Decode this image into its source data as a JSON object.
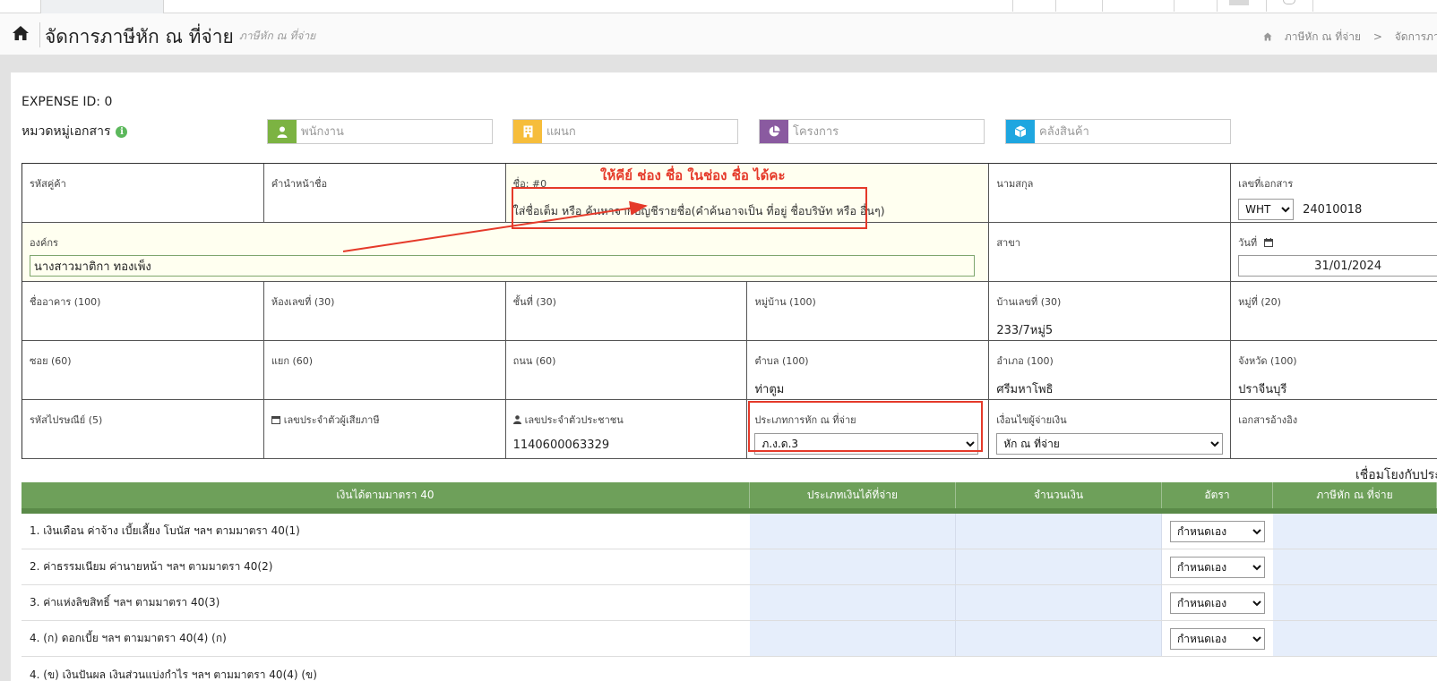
{
  "header": {
    "title": "จัดการภาษีหัก ณ ที่จ่าย",
    "subtitle": "ภาษีหัก ณ ที่จ่าย",
    "breadcrumb": [
      "ภาษีหัก ณ ที่จ่าย",
      "จัดการภาษีห"
    ],
    "breadcrumb_sep": ">"
  },
  "expense_id_label": "EXPENSE ID: 0",
  "doc_category_label": "หมวดหมู่เอกสาร",
  "categories": {
    "employee_placeholder": "พนักงาน",
    "department_placeholder": "แผนก",
    "project_placeholder": "โครงการ",
    "warehouse_placeholder": "คลังสินค้า"
  },
  "colors": {
    "employee": "#7cb342",
    "department": "#f6bd3b",
    "project": "#8a5aa0",
    "warehouse": "#1ea6e0",
    "annotation": "#e53a2a",
    "table_header": "#6ea05a"
  },
  "form": {
    "customer_code_label": "รหัสคู่ค้า",
    "prefix_label": "คำนำหน้าชื่อ",
    "name_label": "ชื่อ: #0",
    "name_hint": "ใส่ชื่อเต็ม หรือ ค้นหาจากบัญชีรายชื่อ(คำค้นอาจเป็น ที่อยู่ ชื่อบริษัท หรือ อื่นๆ)",
    "surname_label": "นามสกุล",
    "doc_no_label": "เลขที่เอกสาร",
    "doc_prefix": "WHT",
    "doc_no_value": "24010018",
    "org_label": "องค์กร",
    "org_value": "นางสาวมาติกา ทองเพ็ง",
    "branch_label": "สาขา",
    "date_label": "วันที่",
    "date_value": "31/01/2024",
    "building_label": "ชื่ออาคาร (100)",
    "room_label": "ห้องเลขที่ (30)",
    "floor_label": "ชั้นที่ (30)",
    "village_label": "หมู่บ้าน (100)",
    "house_no_label": "บ้านเลขที่ (30)",
    "house_no_value": "233/7หมู่5",
    "moo_label": "หมู่ที่ (20)",
    "soi_label": "ซอย (60)",
    "junction_label": "แยก (60)",
    "road_label": "ถนน (60)",
    "subdistrict_label": "ตำบล (100)",
    "subdistrict_value": "ท่าตูม",
    "district_label": "อำเภอ (100)",
    "district_value": "ศรีมหาโพธิ",
    "province_label": "จังหวัด (100)",
    "province_value": "ปราจีนบุรี",
    "postcode_label": "รหัสไปรษณีย์ (5)",
    "taxid_label": "เลขประจำตัวผู้เสียภาษี",
    "citizen_id_label": "เลขประจำตัวประชาชน",
    "citizen_id_value": "1140600063329",
    "wht_type_label": "ประเภทการหัก ณ ที่จ่าย",
    "wht_type_value": "ภ.ง.ด.3",
    "payment_cond_label": "เงื่อนไขผู้จ่ายเงิน",
    "payment_cond_value": "หัก ณ ที่จ่าย",
    "ref_doc_label": "เอกสารอ้างอิง"
  },
  "annotation_text": "ให้คีย์ ช่อง ชื่อ ในช่อง  ชื่อ ได้คะ",
  "link_label": "เชื่อมโยงกับประ",
  "income_table": {
    "headers": [
      "เงินได้ตามมาตรา 40",
      "ประเภทเงินได้ที่จ่าย",
      "จำนวนเงิน",
      "อัตรา",
      "ภาษีหัก ณ ที่จ่าย"
    ],
    "rate_option": "กำหนดเอง",
    "rows": [
      "1. เงินเดือน ค่าจ้าง เบี้ยเลี้ยง โบนัส ฯลฯ ตามมาตรา 40(1)",
      "2. ค่าธรรมเนียม ค่านายหน้า ฯลฯ ตามมาตรา 40(2)",
      "3. ค่าแห่งลิขสิทธิ์ ฯลฯ ตามมาตรา 40(3)",
      "4. (ก) ดอกเบี้ย ฯลฯ ตามมาตรา 40(4) (ก)",
      "4. (ข) เงินปันผล เงินส่วนแบ่งกำไร ฯลฯ ตามมาตรา 40(4) (ข)"
    ]
  }
}
